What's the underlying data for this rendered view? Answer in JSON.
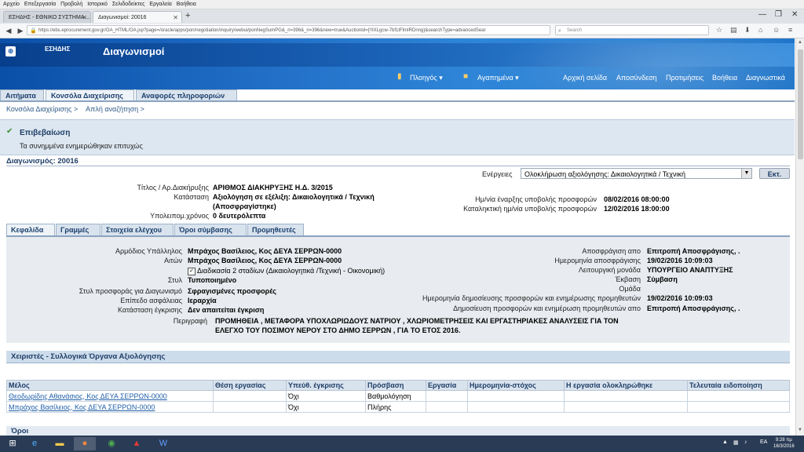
{
  "browser": {
    "menu": [
      "Αρχείο",
      "Επεξεργασία",
      "Προβολή",
      "Ιστορικό",
      "Σελιδοδείκτες",
      "Εργαλεία",
      "Βοήθεια"
    ],
    "tabs": [
      {
        "label": "ΕΣΗΔΗΣ - ΕΘΝΙΚΟ ΣΥΣΤΗΜΑ ...",
        "active": false
      },
      {
        "label": "Διαγωνισμοί: 20016",
        "active": true
      }
    ],
    "url": "https://ebs.eprocurement.gov.gr/OA_HTML/OA.jsp?page=/oracle/apps/pon/negotiation/inquiry/webui/ponNegSumPG&_ri=396&_ri=396&new=true&AuctionId={!!IXLgcw-7bf1tFlmIRDnng}&searchType=advancedSear",
    "search_placeholder": "Search"
  },
  "app": {
    "logo_text": "ΕΣΗΔΗΣ",
    "title": "Διαγωνισμοί",
    "nav_menu": "Πλοηγός",
    "favorites_menu": "Αγαπημένα",
    "header_links": [
      "Αρχική σελίδα",
      "Αποσύνδεση",
      "Προτιμήσεις",
      "Βοήθεια",
      "Διαγνωστικά"
    ],
    "main_tabs": [
      "Αιτήματα",
      "Κονσόλα Διαχείρισης",
      "Αναφορές πληροφοριών"
    ],
    "breadcrumbs": [
      "Κονσόλα Διαχείρισης  >",
      "Απλή αναζήτηση  >"
    ]
  },
  "confirmation": {
    "title": "Επιβεβαίωση",
    "message": "Τα συνημμένα ενημερώθηκαν επιτυχώς"
  },
  "page_title": "Διαγωνισμός: 20016",
  "actions": {
    "label": "Ενέργειες",
    "selected": "Ολοκλήρωση αξιολόγησης: Δικαιολογητικά / Τεχνική",
    "go_label": "Εκτ."
  },
  "summary": {
    "title_label": "Τίτλος / Αρ.Διακήρυξης",
    "title_value": "ΑΡΙΘΜΟΣ ΔΙΑΚΗΡΥΞΗΣ Η.Δ. 3/2015",
    "status_label": "Κατάσταση",
    "status_value_1": "Αξιολόγηση σε εξέλιξη: Δικαιολογητικά / Τεχνική",
    "status_value_2": "(Αποσφραγίστηκε)",
    "remaining_label": "Υπολειπομ.χρόνος",
    "remaining_value": "0 δευτερόλεπτα",
    "start_label": "Ημ/νία έναρξης υποβολής προσφορών",
    "start_value": "08/02/2016 08:00:00",
    "end_label": "Καταληκτική ημ/νία υποβολής προσφορών",
    "end_value": "12/02/2016 18:00:00"
  },
  "sub_tabs": [
    "Κεφαλίδα",
    "Γραμμές",
    "Στοιχεία ελέγχου",
    "Όροι σύμβασης",
    "Προμηθευτές"
  ],
  "header_details": {
    "left": [
      {
        "label": "Αρμόδιος Υπάλληλος",
        "value": "Μπράχος Βασίλειος, Κος ΔΕΥΑ ΣΕΡΡΩΝ-0000",
        "bold": true
      },
      {
        "label": "Αιτών",
        "value": "Μπράχος Βασίλειος, Κος ΔΕΥΑ ΣΕΡΡΩΝ-0000",
        "bold": true
      },
      {
        "label": "",
        "value": "Διαδικασία 2 σταδίων (Δικαιολογητικά /Τεχνική - Οικονομική)",
        "bold": false
      },
      {
        "label": "Στυλ",
        "value": "Τυποποιημένο",
        "bold": true
      },
      {
        "label": "Στυλ προσφοράς για Διαγωνισμό",
        "value": "Σφραγισμένες προσφορές",
        "bold": true
      },
      {
        "label": "Επίπεδο ασφάλειας",
        "value": "Ιεραρχία",
        "bold": true
      },
      {
        "label": "Κατάσταση έγκρισης",
        "value": "Δεν απαιτείται έγκριση",
        "bold": true
      }
    ],
    "right": [
      {
        "label": "Αποσφράγιση απο",
        "value": "Επιτροπή Αποσφράγισης, ."
      },
      {
        "label": "Ημερομηνία αποσφράγισης",
        "value": "19/02/2016 10:09:03"
      },
      {
        "label": "Λειτουργική μονάδα",
        "value": "ΥΠΟΥΡΓΕΙΟ ΑΝΑΠΤΥΞΗΣ"
      },
      {
        "label": "Έκβαση",
        "value": "Σύμβαση"
      },
      {
        "label": "Ομάδα",
        "value": ""
      },
      {
        "label": "Ημερομηνία δημοσίευσης προσφορών και ενημέρωσης προμηθευτών",
        "value": "19/02/2016 10:09:03"
      },
      {
        "label": "Δημοσίευση προσφορών και ενημέρωση προμηθευτών απο",
        "value": "Επιτροπή Αποσφράγισης, ."
      }
    ],
    "description_label": "Περιγραφή",
    "description_1": "ΠΡΟΜΗΘΕΙΑ , ΜΕΤΑΦΟΡΑ ΥΠΟΧΛΩΡΙΩΔΟΥΣ ΝΑΤΡΙΟΥ , ΧΛΩΡΙΟΜΕΤΡΗΣΕΙΣ ΚΑΙ ΕΡΓΑΣΤΗΡΙΑΚΕΣ ΑΝΑΛΥΣΕΙΣ ΓΙΑ ΤΟΝ",
    "description_2": "ΕΛΕΓΧΟ ΤΟΥ ΠΟΣΙΜΟΥ ΝΕΡΟΥ ΣΤΟ ΔΗΜΟ ΣΕΡΡΩΝ , ΓΙΑ ΤΟ ΕΤΟΣ 2016."
  },
  "members_section": {
    "title": "Χειριστές - Συλλογικά Όργανα Αξιολόγησης",
    "columns": [
      "Μέλος",
      "Θέση εργασίας",
      "Υπεύθ. έγκρισης",
      "Πρόσβαση",
      "Εργασία",
      "Ημερομηνία-στόχος",
      "Η εργασία ολοκληρώθηκε",
      "Τελευταία ειδοποίηση"
    ],
    "rows": [
      [
        "Θεοδωρίδης Αθανάσιος, Κος ΔΕΥΑ ΣΕΡΡΩΝ-0000",
        "",
        "Όχι",
        "Βαθμολόγηση",
        "",
        "",
        "",
        ""
      ],
      [
        "Μπράχος Βασίλειος, Κος ΔΕΥΑ ΣΕΡΡΩΝ-0000",
        "",
        "Όχι",
        "Πλήρης",
        "",
        "",
        "",
        ""
      ]
    ]
  },
  "terms_section_title": "Όροι",
  "taskbar": {
    "lang": "EA",
    "time": "9:28 πμ",
    "date": "16/3/2016"
  }
}
